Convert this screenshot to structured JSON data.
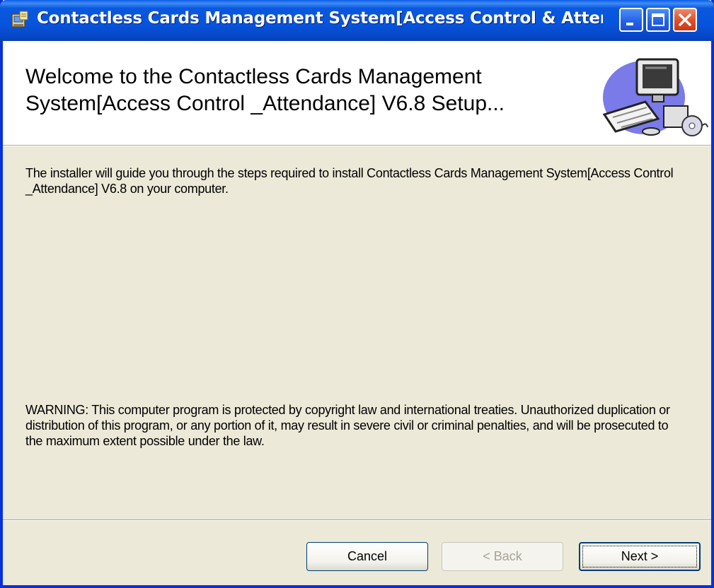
{
  "window": {
    "title": "Contactless Cards Management System[Access Control & Atten...",
    "controls": {
      "minimize": "minimize",
      "maximize": "maximize",
      "close": "close"
    }
  },
  "header": {
    "heading": "Welcome to the Contactless Cards Management System[Access Control _Attendance] V6.8 Setup..."
  },
  "body": {
    "intro": "The installer will guide you through the steps required to install Contactless Cards Management System[Access Control _Attendance] V6.8 on your computer.",
    "warning": "WARNING: This computer program is protected by copyright law and international treaties. Unauthorized duplication or distribution of this program, or any portion of it, may result in severe civil or criminal penalties, and will be prosecuted to the maximum extent possible under the law."
  },
  "buttons": {
    "cancel": "Cancel",
    "back": "< Back",
    "next": "Next >"
  },
  "colors": {
    "titlebar": "#0754dc",
    "frame": "#0831d9",
    "dialog_bg": "#ece9d8",
    "close": "#e0512a"
  },
  "icons": [
    "installer-app-icon",
    "computer-setup-illustration",
    "minimize-icon",
    "maximize-icon",
    "close-icon"
  ]
}
